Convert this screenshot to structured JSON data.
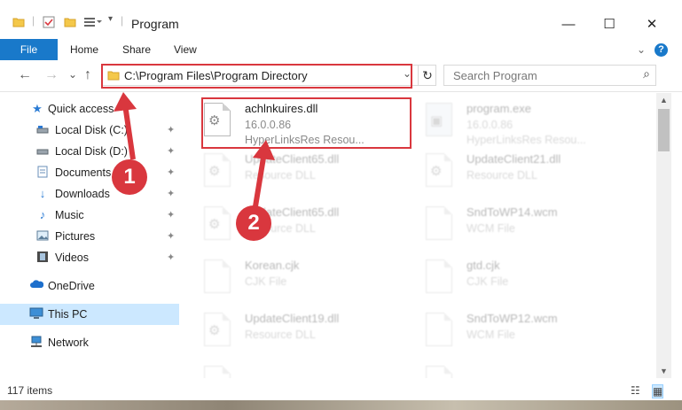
{
  "window": {
    "title": "Program",
    "minimize_label": "—",
    "maximize_label": "☐",
    "close_label": "✕"
  },
  "quick_access_icons": [
    "folder-icon",
    "properties-check-icon",
    "new-folder-icon",
    "customize-icon"
  ],
  "ribbon": {
    "file_label": "File",
    "tabs": [
      "Home",
      "Share",
      "View"
    ],
    "collapse_label": "⌄",
    "help_label": "?"
  },
  "nav": {
    "back_label": "←",
    "forward_label": "→",
    "recent_label": "⌄",
    "up_label": "↑",
    "address": "C:\\Program Files\\Program Directory",
    "address_dropdown": "⌄",
    "refresh_label": "↻",
    "search_placeholder": "Search Program",
    "search_icon": "⌕"
  },
  "sidebar": {
    "items": [
      {
        "label": "Quick access",
        "icon": "star-icon",
        "pinned": false
      },
      {
        "label": "Local Disk (C:)",
        "icon": "drive-icon",
        "pinned": true
      },
      {
        "label": "Local Disk (D:)",
        "icon": "drive-icon",
        "pinned": true
      },
      {
        "label": "Documents",
        "icon": "documents-icon",
        "pinned": true
      },
      {
        "label": "Downloads",
        "icon": "download-icon",
        "pinned": true
      },
      {
        "label": "Music",
        "icon": "music-icon",
        "pinned": true
      },
      {
        "label": "Pictures",
        "icon": "pictures-icon",
        "pinned": true
      },
      {
        "label": "Videos",
        "icon": "video-icon",
        "pinned": true
      },
      {
        "label": "OneDrive",
        "icon": "cloud-icon",
        "pinned": false
      },
      {
        "label": "This PC",
        "icon": "computer-icon",
        "pinned": false,
        "selected": true
      },
      {
        "label": "Network",
        "icon": "network-icon",
        "pinned": false
      }
    ]
  },
  "files": [
    {
      "name": "achlnkuires.dll",
      "line1": "16.0.0.86",
      "line2": "HyperLinksRes Resou...",
      "highlighted": true
    },
    {
      "name": "program.exe",
      "line1": "16.0.0.86",
      "line2": "HyperLinksRes Resou...",
      "highlighted": false
    },
    {
      "name": "UpdateClient65.dll",
      "line1": "Resource DLL",
      "line2": "",
      "highlighted": false
    },
    {
      "name": "UpdateClient21.dll",
      "line1": "Resource DLL",
      "line2": "",
      "highlighted": false
    },
    {
      "name": "UpdateClient65.dll",
      "line1": "Resource DLL",
      "line2": "",
      "highlighted": false
    },
    {
      "name": "SndToWP14.wcm",
      "line1": "WCM File",
      "line2": "",
      "highlighted": false
    },
    {
      "name": "Korean.cjk",
      "line1": "CJK File",
      "line2": "",
      "highlighted": false
    },
    {
      "name": "gtd.cjk",
      "line1": "CJK File",
      "line2": "",
      "highlighted": false
    },
    {
      "name": "UpdateClient19.dll",
      "line1": "Resource DLL",
      "line2": "",
      "highlighted": false
    },
    {
      "name": "SndToWP12.wcm",
      "line1": "WCM File",
      "line2": "",
      "highlighted": false
    }
  ],
  "status": {
    "item_count": "117 items"
  },
  "annotations": {
    "step1": "1",
    "step2": "2",
    "color": "#d9373e"
  }
}
